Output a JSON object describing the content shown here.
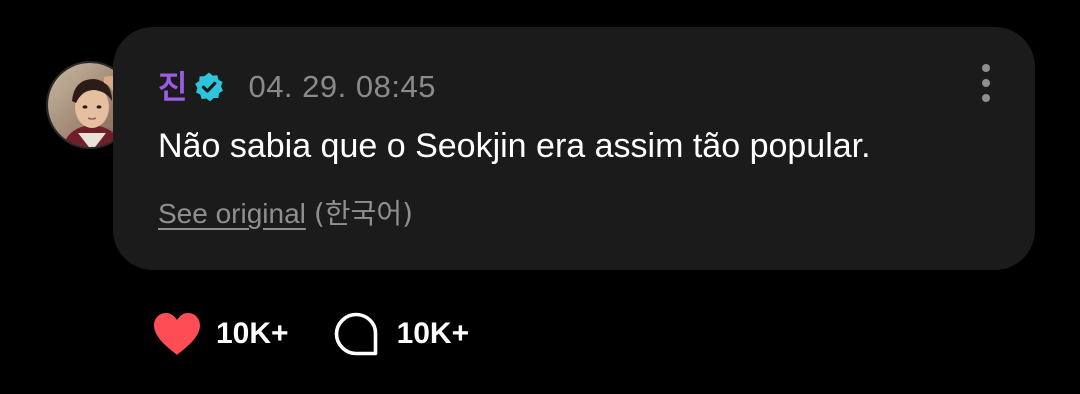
{
  "colors": {
    "background": "#000000",
    "bubble": "#1b1b1b",
    "author_name": "#9b5de5",
    "verified_badge": "#2ec4dc",
    "timestamp": "#8a8a8a",
    "message_text": "#ffffff",
    "secondary_text": "#8f8f8f",
    "like_heart": "#ff4d55",
    "counts": "#ffffff"
  },
  "post": {
    "author": {
      "name": "진",
      "verified": true,
      "verified_icon": "verified-badge-icon",
      "avatar_icon": "profile-photo"
    },
    "timestamp": "04. 29. 08:45",
    "message": "Não sabia que o Seokjin era assim tão popular.",
    "translation": {
      "see_original_label": "See original",
      "language_note": "(한국어)"
    },
    "menu_icon": "more-vertical-icon"
  },
  "actions": {
    "likes": {
      "icon": "heart-icon",
      "count": "10K+"
    },
    "comments": {
      "icon": "comment-bubble-icon",
      "count": "10K+"
    }
  }
}
